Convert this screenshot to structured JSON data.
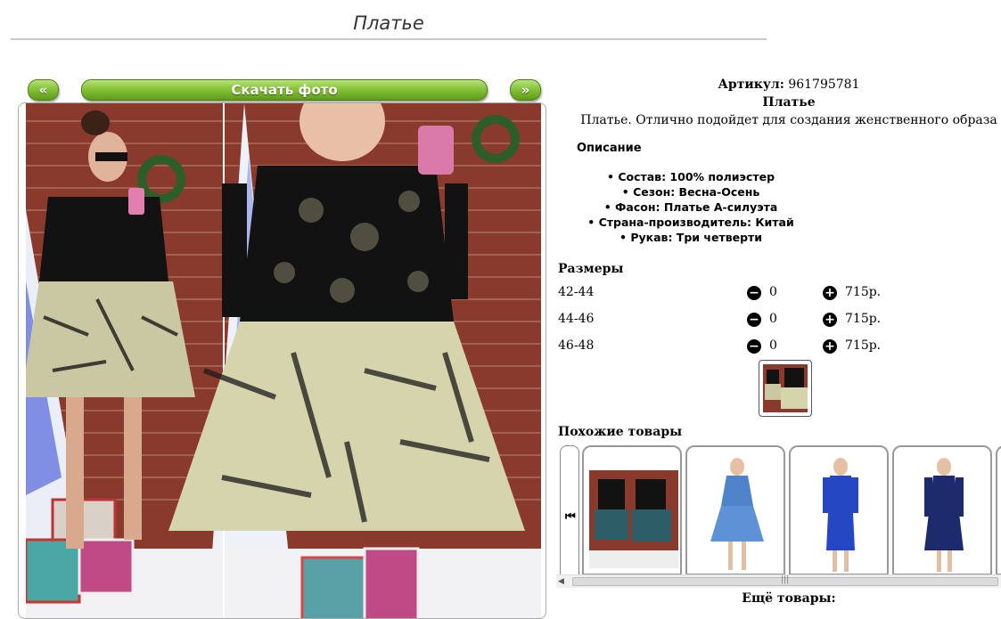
{
  "page": {
    "title": "Платье"
  },
  "gallery": {
    "prev_label": "«",
    "download_label": "Скачать фото",
    "next_label": "»"
  },
  "product": {
    "sku_label": "Артикул:",
    "sku_value": "961795781",
    "name": "Платье",
    "short_description": "Платье. Отлично подойдет для создания женственного образа",
    "description_heading": "Описание",
    "attributes": [
      "Состав: 100% полиэстер",
      "Сезон: Весна-Осень",
      "Фасон: Платье А-силуэта",
      "Страна-производитель: Китай",
      "Рукав: Три четверти"
    ]
  },
  "sizes": {
    "heading": "Размеры",
    "rows": [
      {
        "size": "42-44",
        "qty": "0",
        "price": "715р."
      },
      {
        "size": "44-46",
        "qty": "0",
        "price": "715р."
      },
      {
        "size": "46-48",
        "qty": "0",
        "price": "715р."
      }
    ]
  },
  "similar": {
    "heading": "Похожие товары",
    "more_label": "Ещё товары:"
  },
  "colors": {
    "button_green": "#86c43a",
    "button_border": "#4d7f12"
  }
}
